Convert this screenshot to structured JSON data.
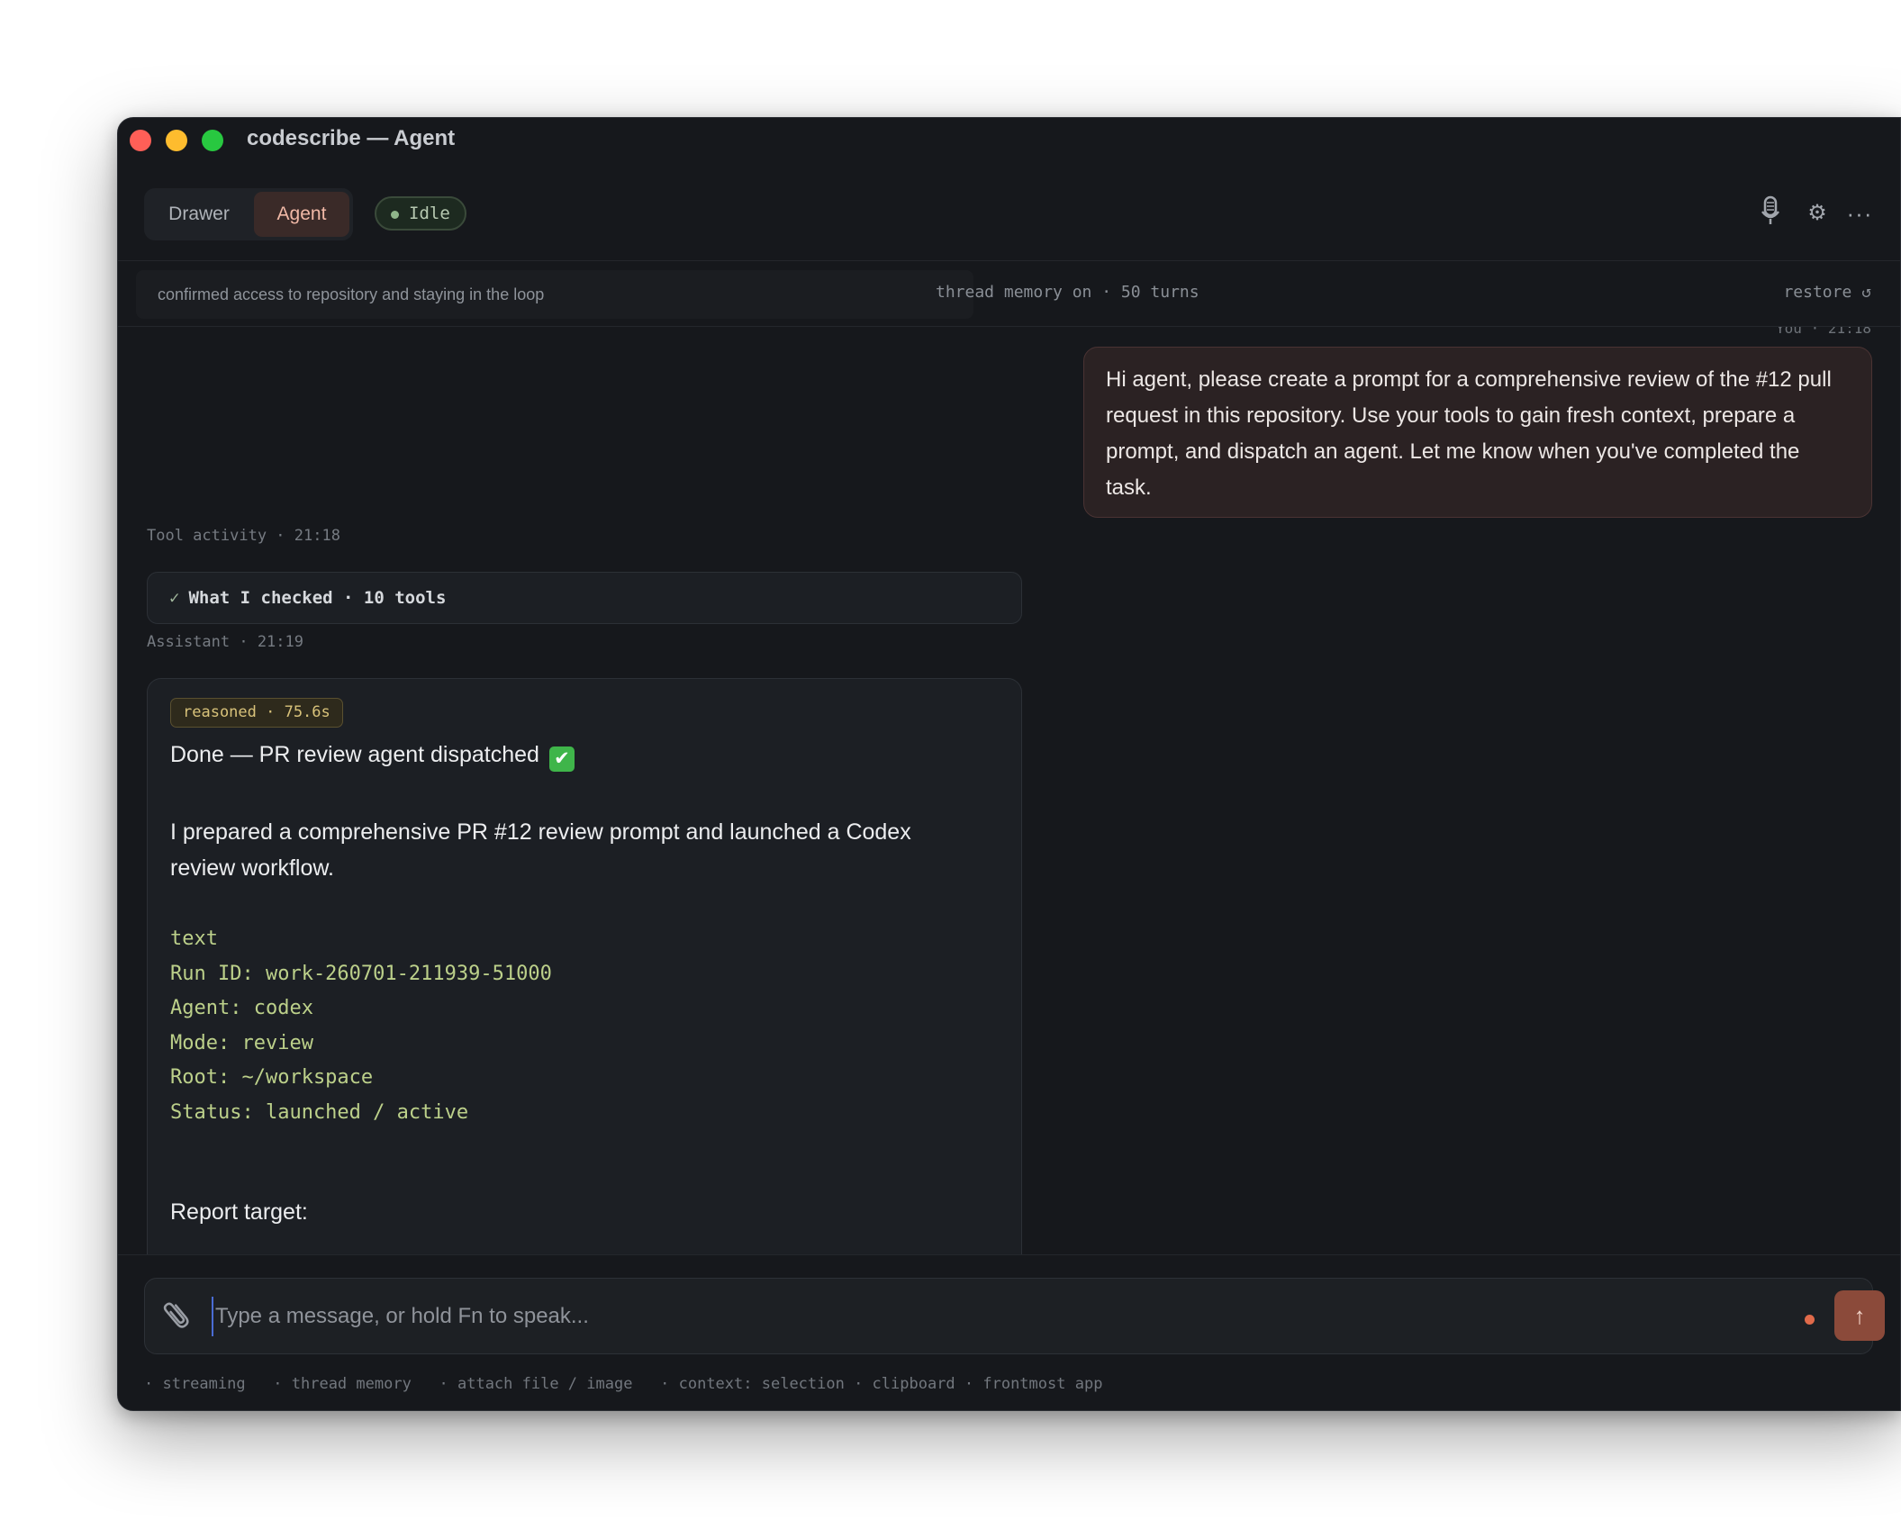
{
  "window": {
    "title": "codescribe — Agent"
  },
  "toolbar": {
    "tabs": [
      {
        "label": "Drawer"
      },
      {
        "label": "Agent"
      }
    ],
    "status": "Idle",
    "icons": [
      "microphone-icon",
      "gear-icon",
      "more-icon"
    ]
  },
  "memory_bar": {
    "summary": "confirmed access to repository and staying in the loop",
    "memory_status": "thread memory on · 50 turns",
    "restore_label": "restore ↺"
  },
  "conversation": {
    "user_message": {
      "meta": "You · 21:18",
      "text": "Hi agent, please create a prompt for a comprehensive review of the #12 pull request in this repository. Use your tools to gain fresh context, prepare a prompt, and dispatch an agent. Let me know when you've completed the task."
    },
    "tool_activity": {
      "meta": "Tool activity · 21:18",
      "summary": "What I checked · 10 tools"
    },
    "assistant_message": {
      "meta": "Assistant · 21:19",
      "badge": "reasoned · 75.6s",
      "headline": "Done — PR review agent dispatched",
      "headline_emoji": "✔",
      "paragraph": "I prepared a comprehensive PR #12 review prompt and launched a Codex review workflow.",
      "code_lines": [
        "text",
        "Run ID: work-260701-211939-51000",
        "Agent: codex",
        "Mode: review",
        "Root: ~/workspace",
        "Status: launched / active"
      ],
      "report_label": "Report target:"
    }
  },
  "composer": {
    "placeholder": "Type a message, or hold Fn to speak...",
    "value": "",
    "send_icon": "arrow-up-icon",
    "hints": "· streaming   · thread memory   · attach file / image   · context: selection · clipboard · frontmost app"
  },
  "colors": {
    "accent": "#f0b8a6",
    "send_button": "#8b4a3a",
    "code_text": "#bcd08a",
    "status_dot": "#8fb58a"
  }
}
